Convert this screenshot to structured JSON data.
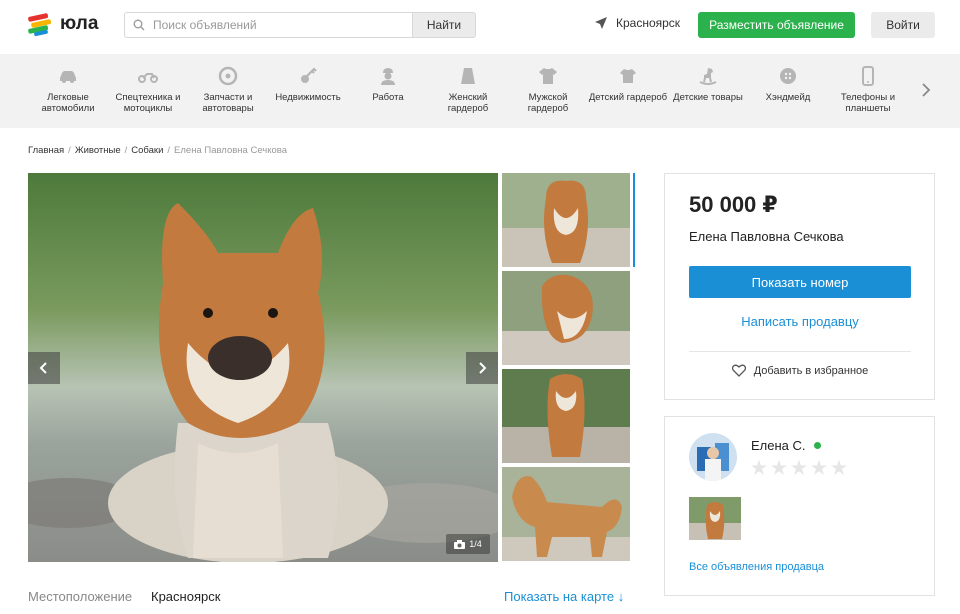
{
  "header": {
    "logo_text": "юла",
    "search_placeholder": "Поиск объявлений",
    "search_button": "Найти",
    "city": "Красноярск",
    "place_ad_button": "Разместить объявление",
    "login_button": "Войти"
  },
  "categories": [
    {
      "label": "Легковые автомобили",
      "icon": "car-icon"
    },
    {
      "label": "Спецтехника и мотоциклы",
      "icon": "motorcycle-icon"
    },
    {
      "label": "Запчасти и автотовары",
      "icon": "wheel-icon"
    },
    {
      "label": "Недвижимость",
      "icon": "key-icon"
    },
    {
      "label": "Работа",
      "icon": "worker-icon"
    },
    {
      "label": "Женский гардероб",
      "icon": "skirt-icon"
    },
    {
      "label": "Мужской гардероб",
      "icon": "tshirt-icon"
    },
    {
      "label": "Детский гардероб",
      "icon": "kids-shirt-icon"
    },
    {
      "label": "Детские товары",
      "icon": "rocking-horse-icon"
    },
    {
      "label": "Хэндмейд",
      "icon": "button-icon"
    },
    {
      "label": "Телефоны и планшеты",
      "icon": "phone-icon"
    }
  ],
  "breadcrumbs": [
    "Главная",
    "Животные",
    "Собаки",
    "Елена Павловна Сечкова"
  ],
  "gallery": {
    "counter": "1/4",
    "thumbnail_count": 4
  },
  "ad": {
    "price": "50 000 ₽",
    "seller_full_name": "Елена Павловна Сечкова",
    "show_phone_button": "Показать номер",
    "write_seller_link": "Написать продавцу",
    "add_favorite": "Добавить в избранное"
  },
  "seller": {
    "name": "Елена С.",
    "rating_stars": 0,
    "all_ads_link": "Все объявления продавца"
  },
  "location": {
    "label": "Местоположение",
    "value": "Красноярск",
    "map_link": "Показать на карте ↓"
  },
  "colors": {
    "green": "#2bb24c",
    "blue": "#1a8fd6",
    "catbar_bg": "#f2f2f2"
  }
}
